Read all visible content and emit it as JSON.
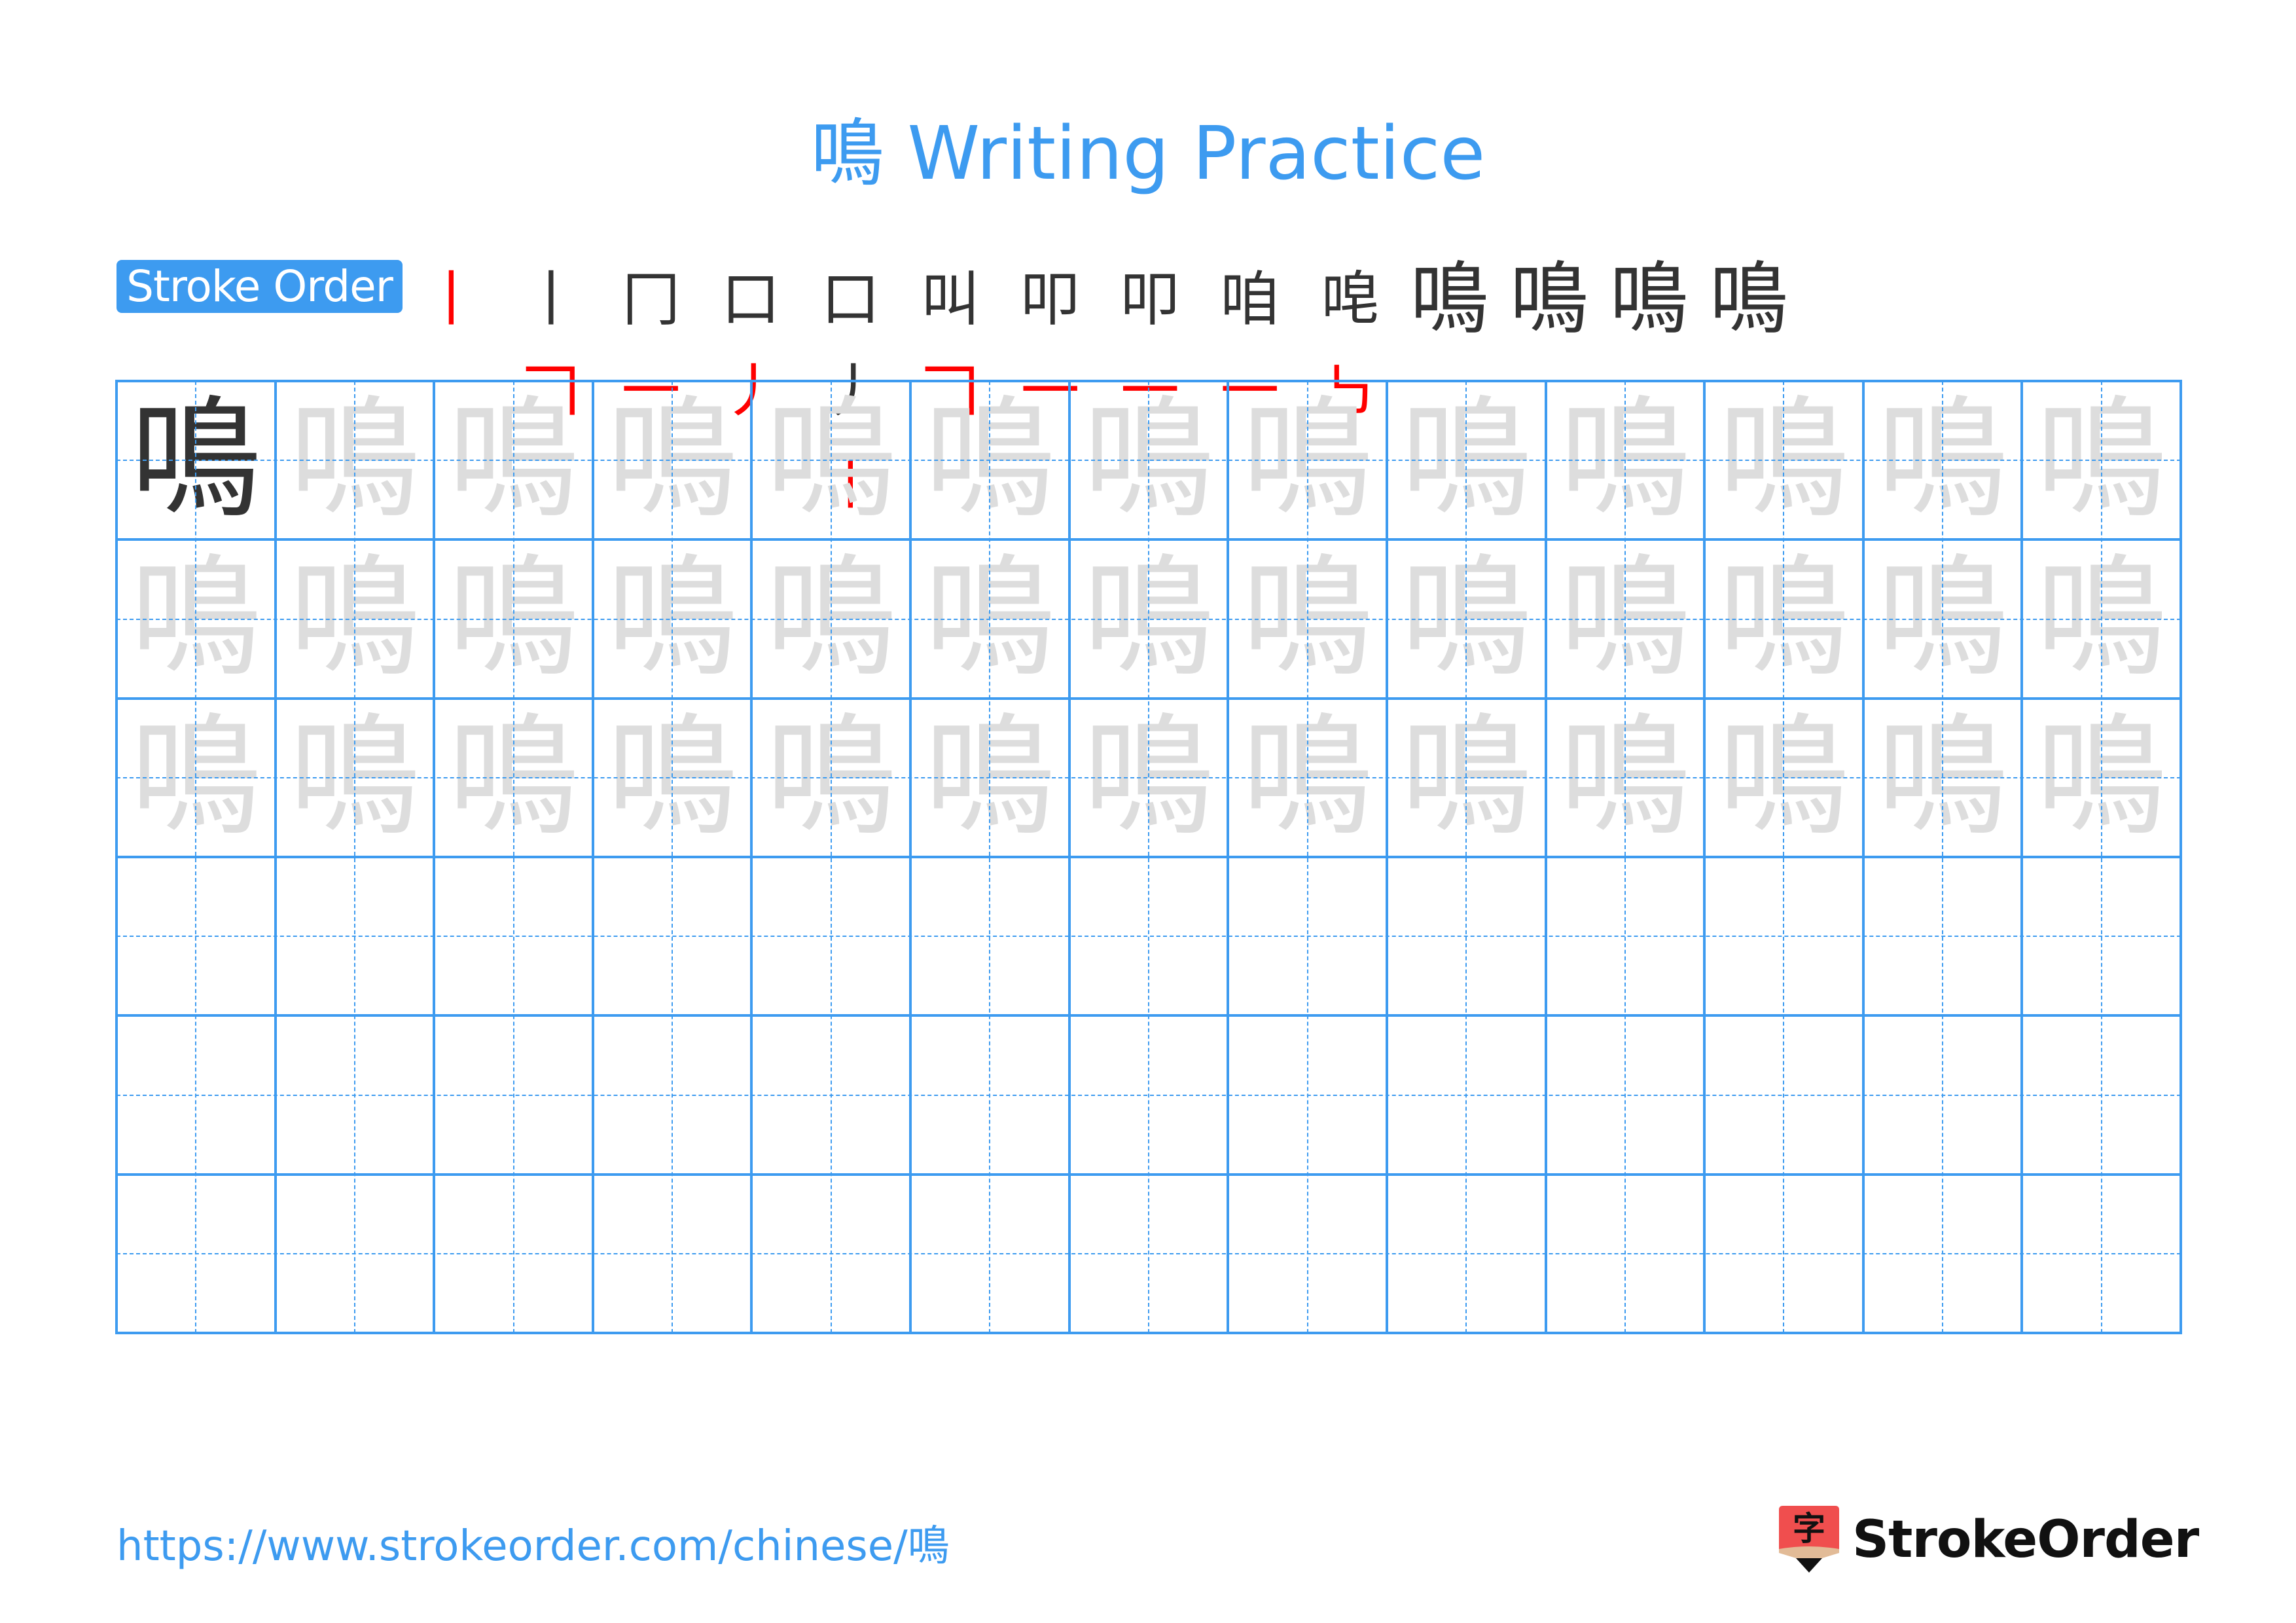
{
  "character": "鳴",
  "title": "鳴 Writing Practice",
  "stroke_order": {
    "label": "Stroke Order",
    "stroke_count": 14,
    "steps": [
      {
        "step": 1,
        "done": "",
        "new": "丨"
      },
      {
        "step": 2,
        "done": "丨",
        "new": "𠃍"
      },
      {
        "step": 3,
        "done": "冂",
        "new": "一"
      },
      {
        "step": 4,
        "done": "口",
        "new": "丿"
      },
      {
        "step": 5,
        "done": "口丿",
        "new": "丨"
      },
      {
        "step": 6,
        "done": "叫",
        "new": "𠃍"
      },
      {
        "step": 7,
        "done": "叩",
        "new": "一"
      },
      {
        "step": 8,
        "done": "叩",
        "new": "一"
      },
      {
        "step": 9,
        "done": "咱",
        "new": "一"
      },
      {
        "step": 10,
        "done": "唣",
        "new": "㇉"
      },
      {
        "step": 11,
        "done": "鳴",
        "new": ""
      },
      {
        "step": 12,
        "done": "鳴",
        "new": ""
      },
      {
        "step": 13,
        "done": "鳴",
        "new": ""
      },
      {
        "step": 14,
        "done": "鳴",
        "new": ""
      }
    ]
  },
  "practice_grid": {
    "columns": 13,
    "rows": 6,
    "model_cells": 1,
    "trace_rows": 3,
    "empty_rows": 3
  },
  "footer": {
    "url": "https://www.strokeorder.com/chinese/鳴",
    "brand_icon_glyph": "字",
    "brand_name": "StrokeOrder"
  },
  "colors": {
    "accent": "#3d9bf0",
    "model_glyph": "#333333",
    "trace_glyph": "#dddddd",
    "highlight_stroke": "#ff0000",
    "logo_red": "#f04e4e",
    "logo_tan": "#e2bb97"
  }
}
